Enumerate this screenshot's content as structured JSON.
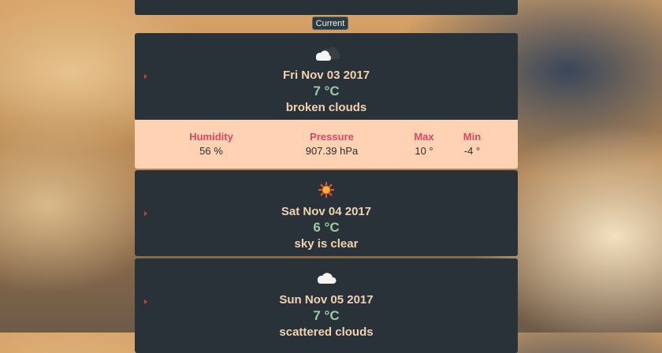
{
  "current_button": "Current",
  "cards": [
    {
      "date": "Fri Nov 03 2017",
      "temp": "7 °C",
      "description": "broken clouds",
      "icon": "broken-clouds-icon"
    },
    {
      "date": "Sat Nov 04 2017",
      "temp": "6 °C",
      "description": "sky is clear",
      "icon": "clear-sky-icon"
    },
    {
      "date": "Sun Nov 05 2017",
      "temp": "7 °C",
      "description": "scattered clouds",
      "icon": "scattered-clouds-icon"
    }
  ],
  "details": {
    "humidity": {
      "label": "Humidity",
      "value": "56 %"
    },
    "pressure": {
      "label": "Pressure",
      "value": "907.39 hPa"
    },
    "max": {
      "label": "Max",
      "value": "10 °"
    },
    "min": {
      "label": "Min",
      "value": "-4 °"
    }
  },
  "colors": {
    "card_bg": "#283238",
    "details_bg": "#ffd2b3",
    "label_red": "#de4463",
    "temp_green": "#9cc9a4",
    "text_peach": "#f3d2b1"
  }
}
